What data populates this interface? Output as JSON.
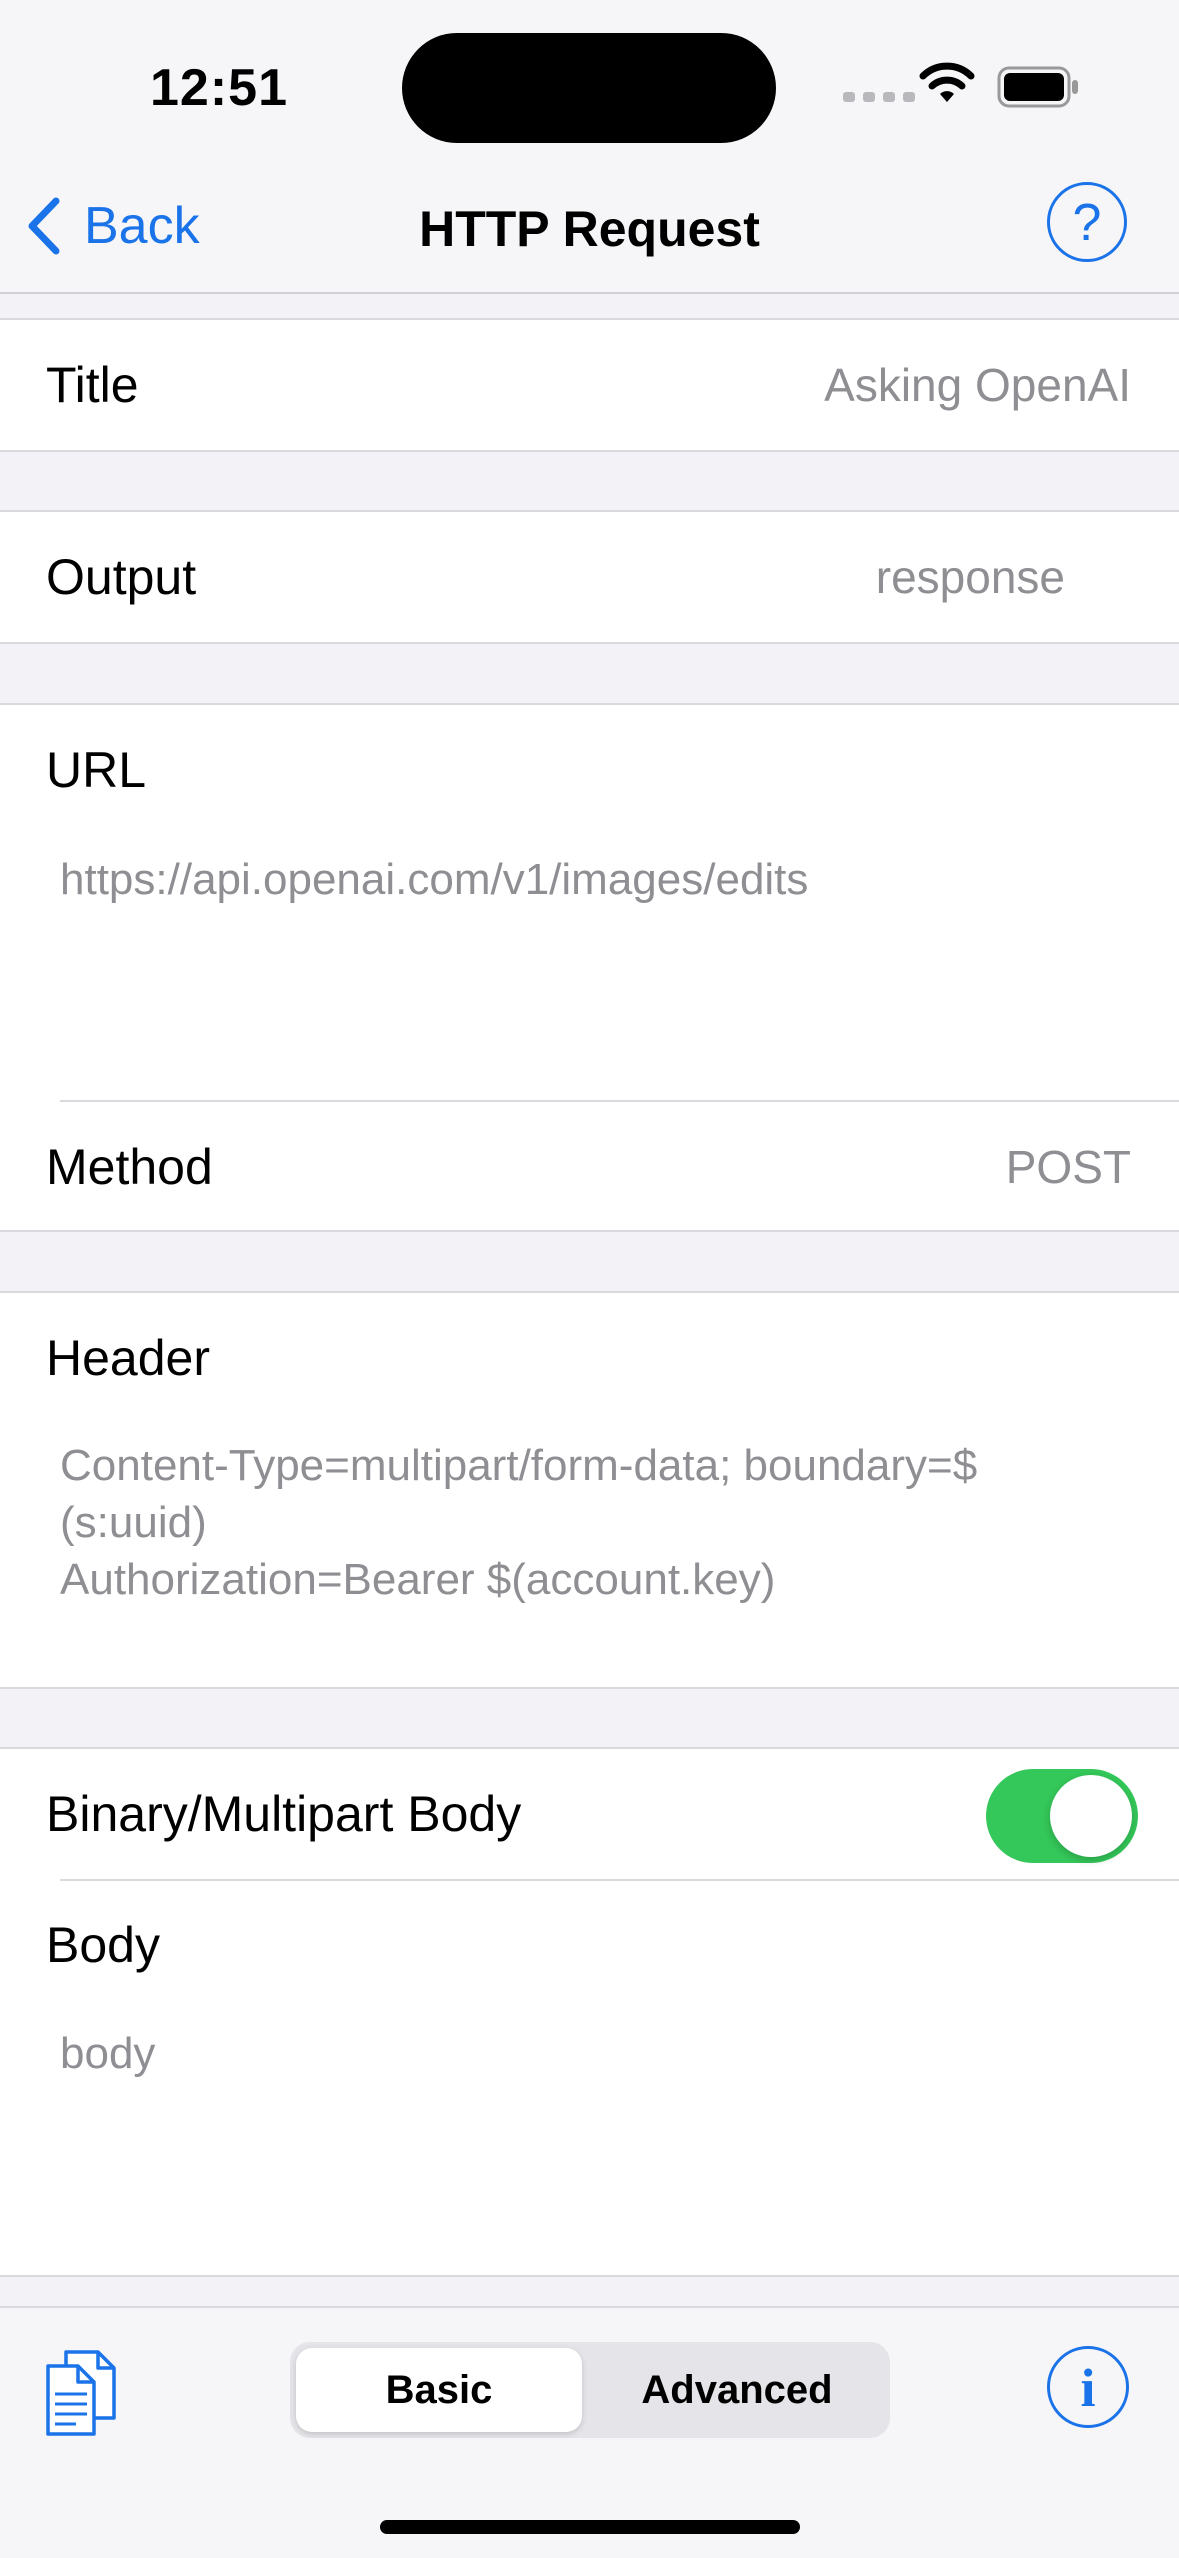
{
  "status_bar": {
    "time": "12:51"
  },
  "nav": {
    "back_label": "Back",
    "title": "HTTP Request",
    "help_label": "?"
  },
  "fields": {
    "title": {
      "label": "Title",
      "value": "Asking OpenAI"
    },
    "output": {
      "label": "Output",
      "value": "response"
    },
    "url": {
      "label": "URL",
      "value": "https://api.openai.com/v1/images/edits"
    },
    "method": {
      "label": "Method",
      "value": "POST"
    },
    "header": {
      "label": "Header",
      "value": "Content-Type=multipart/form-data; boundary=$\n(s:uuid)\nAuthorization=Bearer $(account.key)"
    },
    "binary_body": {
      "label": "Binary/Multipart Body",
      "enabled": true
    },
    "body": {
      "label": "Body",
      "value": "body"
    }
  },
  "toolbar": {
    "segments": [
      "Basic",
      "Advanced"
    ],
    "selected": "Basic",
    "info_label": "i"
  },
  "colors": {
    "accent": "#1A73E8",
    "toggle_on": "#34C759"
  }
}
